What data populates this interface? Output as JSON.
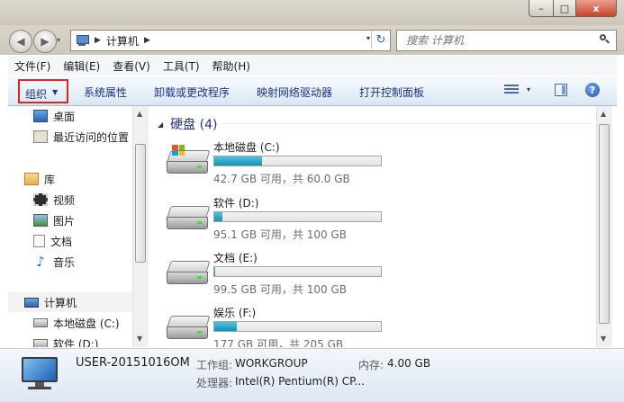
{
  "window": {
    "controls": {
      "minimize": "–",
      "maximize": "□",
      "close": "x"
    }
  },
  "nav": {
    "back": "◀",
    "forward": "▶",
    "history_dropdown": "▾"
  },
  "address": {
    "separator_1": "▶",
    "location": "计算机",
    "separator_2": "▶",
    "dropdown": "▾",
    "refresh": "↻"
  },
  "search": {
    "placeholder": "搜索 计算机"
  },
  "menubar": [
    "文件(F)",
    "编辑(E)",
    "查看(V)",
    "工具(T)",
    "帮助(H)"
  ],
  "command_bar": {
    "organize": "组织",
    "organize_caret": "▼",
    "system_properties": "系统属性",
    "uninstall": "卸载或更改程序",
    "map_drive": "映射网络驱动器",
    "control_panel": "打开控制面板",
    "view_dropdown": "▾",
    "help": "?"
  },
  "nav_pane": {
    "items": [
      {
        "label": "桌面",
        "icon": "desktop-icon"
      },
      {
        "label": "最近访问的位置",
        "icon": "recent-places-icon"
      },
      {
        "label": "库",
        "icon": "library-icon"
      },
      {
        "label": "视频",
        "icon": "video-icon"
      },
      {
        "label": "图片",
        "icon": "pictures-icon"
      },
      {
        "label": "文档",
        "icon": "documents-icon"
      },
      {
        "label": "音乐",
        "icon": "music-icon"
      },
      {
        "label": "计算机",
        "icon": "computer-icon"
      },
      {
        "label": "本地磁盘 (C:)",
        "icon": "drive-icon"
      },
      {
        "label": "软件 (D:)",
        "icon": "drive-icon"
      }
    ],
    "scroll_up": "▲",
    "scroll_down": "▼"
  },
  "content": {
    "group_caret": "◢",
    "group_title": "硬盘 (4)",
    "drives": [
      {
        "name": "本地磁盘 (C:)",
        "info": "42.7 GB 可用，共 60.0 GB",
        "used_fraction": 0.288,
        "system": true
      },
      {
        "name": "软件 (D:)",
        "info": "95.1 GB 可用，共 100 GB",
        "used_fraction": 0.049,
        "system": false
      },
      {
        "name": "文档 (E:)",
        "info": "99.5 GB 可用，共 100 GB",
        "used_fraction": 0.005,
        "system": false
      },
      {
        "name": "娱乐 (F:)",
        "info": "177 GB 可用，共 205 GB",
        "used_fraction": 0.137,
        "system": false
      }
    ],
    "scroll_up": "▲",
    "scroll_down": "▼"
  },
  "details": {
    "computer_name": "USER-20151016OM",
    "workgroup_label": "工作组:",
    "workgroup_value": "WORKGROUP",
    "memory_label": "内存:",
    "memory_value": "4.00 GB",
    "processor_label": "处理器:",
    "processor_value": "Intel(R) Pentium(R) CP..."
  },
  "colors": {
    "bar_fill": "#178fb4",
    "highlight": "#e0261b",
    "link": "#1e3287"
  }
}
